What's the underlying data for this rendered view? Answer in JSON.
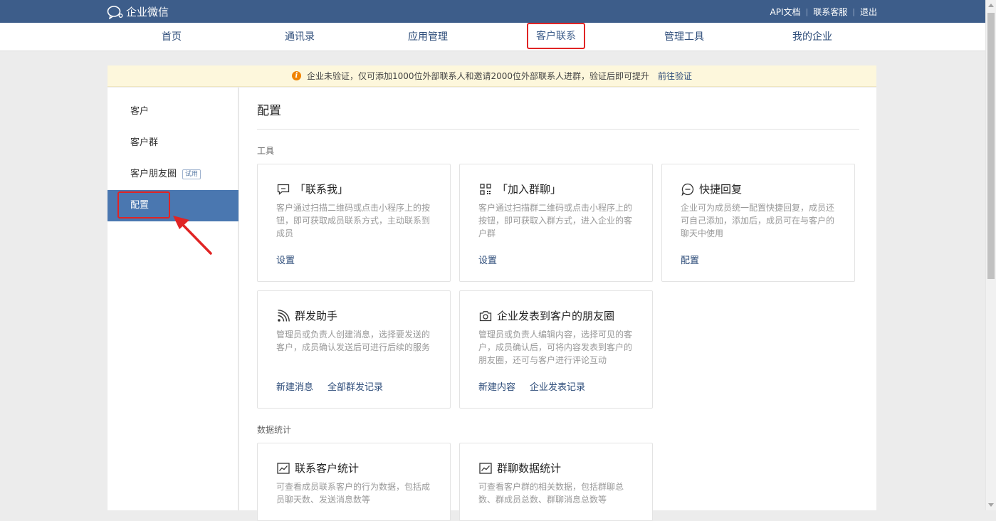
{
  "brand": {
    "name": "企业微信",
    "icon": "chat-bubble-icon"
  },
  "top_links": [
    {
      "label": "API文档"
    },
    {
      "label": "联系客服"
    },
    {
      "label": "退出"
    }
  ],
  "nav": {
    "items": [
      {
        "label": "首页"
      },
      {
        "label": "通讯录"
      },
      {
        "label": "应用管理"
      },
      {
        "label": "客户联系",
        "active": true
      },
      {
        "label": "管理工具"
      },
      {
        "label": "我的企业"
      }
    ]
  },
  "notice": {
    "icon": "warning-icon",
    "text": "企业未验证，仅可添加1000位外部联系人和邀请2000位外部联系人进群，验证后即可提升",
    "link": "前往验证"
  },
  "sidebar": {
    "items": [
      {
        "label": "客户"
      },
      {
        "label": "客户群"
      },
      {
        "label": "客户朋友圈",
        "badge": "试用"
      },
      {
        "label": "配置",
        "active": true
      }
    ]
  },
  "page_title": "配置",
  "sections": {
    "tools": "工具",
    "stats": "数据统计"
  },
  "cards": [
    {
      "title": "「联系我」",
      "icon": "message-icon",
      "desc": "客户通过扫描二维码或点击小程序上的按钮，即可获取成员联系方式，主动联系到成员",
      "links": [
        "设置"
      ]
    },
    {
      "title": "「加入群聊」",
      "icon": "qrcode-icon",
      "desc": "客户通过扫描群二维码或点击小程序上的按钮，即可获取入群方式，进入企业的客户群",
      "links": [
        "设置"
      ]
    },
    {
      "title": "快捷回复",
      "icon": "quick-reply-icon",
      "desc": "企业可为成员统一配置快捷回复，成员还可自己添加，添加后，成员可在与客户的聊天中使用",
      "links": [
        "配置"
      ]
    },
    {
      "title": "群发助手",
      "icon": "broadcast-icon",
      "desc": "管理员或负责人创建消息，选择要发送的客户，成员确认发送后可进行后续的服务",
      "links": [
        "新建消息",
        "全部群发记录"
      ]
    },
    {
      "title": "企业发表到客户的朋友圈",
      "icon": "camera-icon",
      "desc": "管理员或负责人编辑内容，选择可见的客户，成员确认后，可将内容发表到客户的朋友圈，还可与客户进行评论互动",
      "links": [
        "新建内容",
        "企业发表记录"
      ]
    },
    {
      "title": "联系客户统计",
      "icon": "chart-icon",
      "desc": "可查看成员联系客户的行为数据，包括成员聊天数、发送消息数等",
      "links": []
    },
    {
      "title": "群聊数据统计",
      "icon": "chart-icon",
      "desc": "可查看客户群的相关数据，包括群聊总数、群成员总数、群聊消息总数等",
      "links": []
    }
  ],
  "colors": {
    "topbar": "#3d5d8a",
    "accent": "#4a77b0",
    "link": "#2e4d7a",
    "highlight": "#e02424",
    "notice_bg": "#fdf7dc",
    "warning": "#f08300"
  }
}
